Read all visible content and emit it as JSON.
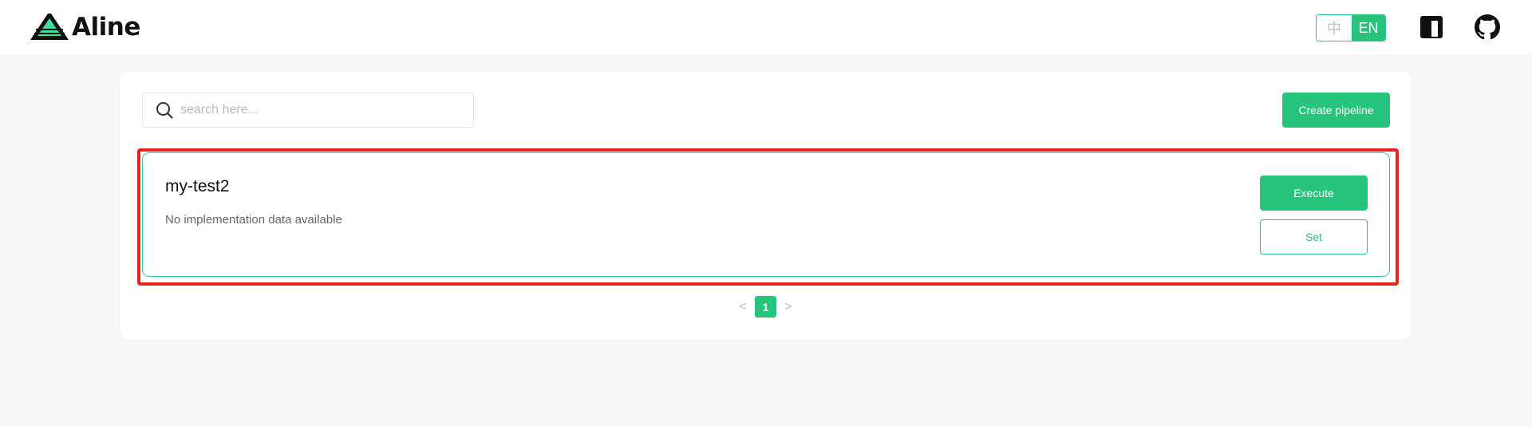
{
  "header": {
    "app_name": "Aline",
    "lang": {
      "zh_label": "中",
      "en_label": "EN",
      "active": "EN"
    },
    "icons": {
      "npm": "npm-icon",
      "github": "github-icon"
    }
  },
  "toolbar": {
    "search_placeholder": "search here...",
    "search_value": "",
    "create_label": "Create pipeline"
  },
  "pipelines": [
    {
      "name": "my-test2",
      "description": "No implementation data available",
      "execute_label": "Execute",
      "set_label": "Set"
    }
  ],
  "pagination": {
    "current_page": "1",
    "prev": "<",
    "next": ">"
  },
  "colors": {
    "accent": "#26c47c",
    "highlight": "#e8231e",
    "background": "#f7f7f7"
  }
}
